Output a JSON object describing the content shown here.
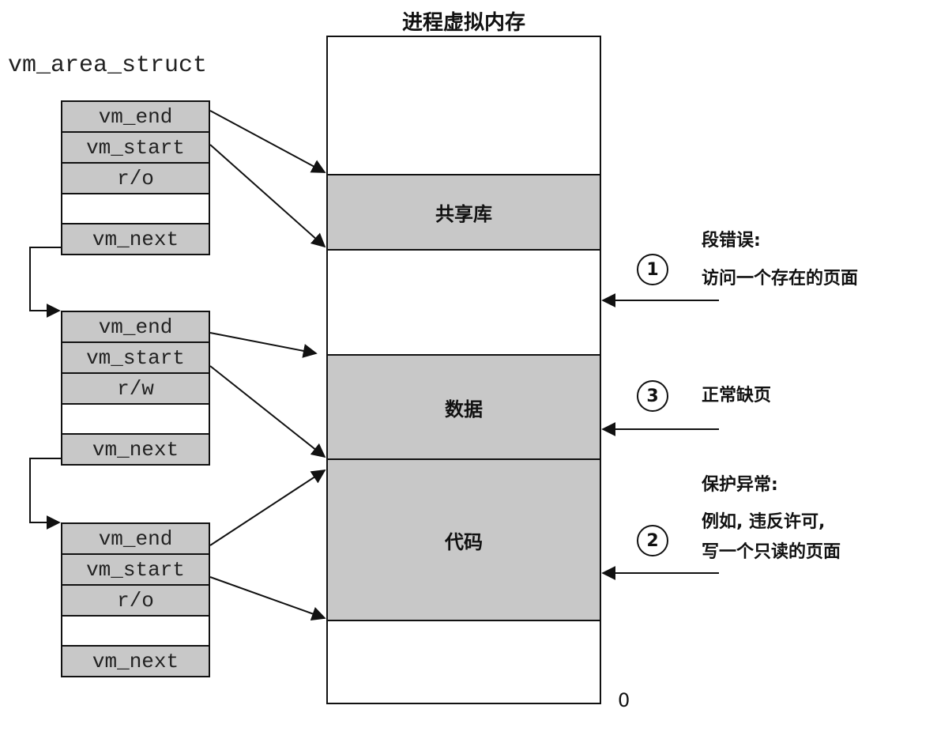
{
  "struct_title": "vm_area_struct",
  "vm_areas": [
    {
      "fields": [
        "vm_end",
        "vm_start",
        "r/o",
        "",
        "vm_next"
      ]
    },
    {
      "fields": [
        "vm_end",
        "vm_start",
        "r/w",
        "",
        "vm_next"
      ]
    },
    {
      "fields": [
        "vm_end",
        "vm_start",
        "r/o",
        "",
        "vm_next"
      ]
    }
  ],
  "memory": {
    "title": "进程虚拟内存",
    "segments": {
      "shared": "共享库",
      "data": "数据",
      "code": "代码"
    },
    "zero": "0"
  },
  "faults": [
    {
      "number": "1",
      "title": "段错误:",
      "detail": "访问一个存在的页面"
    },
    {
      "number": "3",
      "title": "正常缺页",
      "detail": ""
    },
    {
      "number": "2",
      "title": "保护异常:",
      "detail": "例如, 违反许可,\n写一个只读的页面"
    }
  ]
}
